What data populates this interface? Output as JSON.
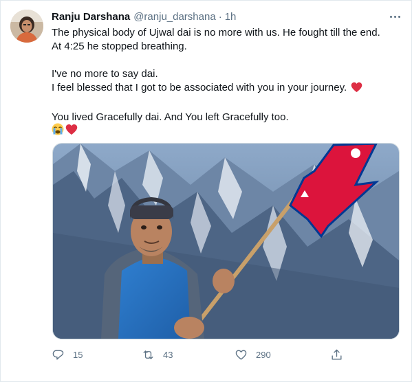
{
  "tweet": {
    "author_name": "Ranju Darshana",
    "author_handle": "@ranju_darshana",
    "separator": "·",
    "time": "1h",
    "lines": {
      "l1": "The physical body of Ujwal dai is no more with us. He fought till the end.",
      "l2": "At 4:25 he stopped breathing.",
      "l3": "I've no more to say dai.",
      "l4": "I feel blessed that I got to be associated with you in your journey.",
      "l5": "You lived Gracefully dai. And You left Gracefully too."
    },
    "emojis": [
      "crying-face-emoji",
      "red-heart-emoji"
    ],
    "media": {
      "description_name": "photo-man-with-nepal-flag-mountains"
    },
    "actions": {
      "replies": "15",
      "retweets": "43",
      "likes": "290"
    },
    "colors": {
      "secondary_text": "#5b7083",
      "heart_red": "#e0245e",
      "flag_red": "#dc143c",
      "flag_blue": "#003893"
    }
  }
}
